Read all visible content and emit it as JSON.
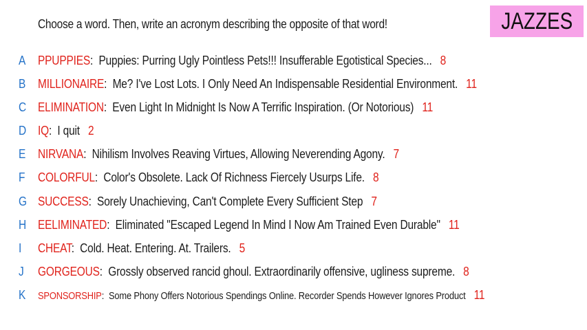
{
  "prompt": "Choose a word. Then, write an acronym describing the opposite of that word!",
  "badge": "JAZZES",
  "colors": {
    "letter": "#2472c8",
    "word": "#e0221b",
    "score": "#e0221b",
    "badge_bg": "#f7a3e8"
  },
  "entries": [
    {
      "letter": "A",
      "word": "PPUPPIES",
      "colon": ":",
      "text": "Puppies: Purring Ugly Pointless Pets!!! Insufferable Egotistical Species...",
      "score": "8"
    },
    {
      "letter": "B",
      "word": "MILLIONAIRE",
      "colon": ":",
      "text": "Me? I've Lost Lots. I Only Need An Indispensable Residential Environment.",
      "score": "11"
    },
    {
      "letter": "C",
      "word": "ELIMINATION",
      "colon": ":",
      "text": "Even Light In Midnight Is Now A Terrific Inspiration. (Or Notorious)",
      "score": "11"
    },
    {
      "letter": "D",
      "word": "IQ",
      "colon": ":",
      "text": "I quit",
      "score": "2"
    },
    {
      "letter": "E",
      "word": "NIRVANA",
      "colon": ":",
      "text": "Nihilism Involves Reaving Virtues, Allowing Neverending Agony.",
      "score": "7"
    },
    {
      "letter": "F",
      "word": "COLORFUL",
      "colon": ":",
      "text": "Color's Obsolete. Lack Of Richness Fiercely Usurps Life.",
      "score": "8"
    },
    {
      "letter": "G",
      "word": "SUCCESS",
      "colon": ":",
      "text": "Sorely Unachieving, Can't Complete Every Sufficient Step",
      "score": "7"
    },
    {
      "letter": "H",
      "word": "EELIMINATED",
      "colon": ":",
      "text": "Eliminated \"Escaped Legend In Mind I Now Am Trained Even Durable\"",
      "score": "11"
    },
    {
      "letter": "I",
      "word": "CHEAT",
      "colon": ":",
      "text": "Cold. Heat. Entering. At. Trailers.",
      "score": "5"
    },
    {
      "letter": "J",
      "word": "GORGEOUS",
      "colon": ":",
      "text": "Grossly observed rancid ghoul. Extraordinarily offensive, ugliness supreme.",
      "score": "8"
    },
    {
      "letter": "K",
      "word": "SPONSORSHIP",
      "colon": ":",
      "text": "Some Phony Offers Notorious Spendings Online. Recorder Spends However Ignores Product",
      "score": "11"
    }
  ]
}
